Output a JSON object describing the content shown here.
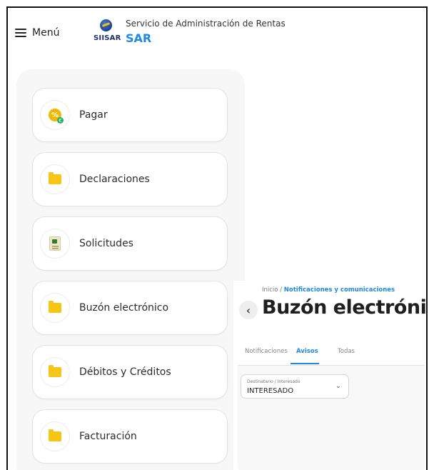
{
  "header": {
    "menu_label": "Menú",
    "logo_text": "SIISAR",
    "org_name": "Servicio de Administración de Rentas",
    "org_short": "SAR"
  },
  "menu": {
    "items": [
      {
        "label": "Pagar",
        "icon": "coin-icon"
      },
      {
        "label": "Declaraciones",
        "icon": "folder-icon"
      },
      {
        "label": "Solicitudes",
        "icon": "document-icon"
      },
      {
        "label": "Buzón electrónico",
        "icon": "folder-icon"
      },
      {
        "label": "Débitos y Créditos",
        "icon": "folder-icon"
      },
      {
        "label": "Facturación",
        "icon": "folder-icon"
      }
    ]
  },
  "inset": {
    "breadcrumb_home": "Inicio",
    "breadcrumb_sep": "/",
    "breadcrumb_current": "Notificaciones y comunicaciones",
    "back_glyph": "‹",
    "title": "Buzón electrónico",
    "tabs": [
      "Notificaciones",
      "Avisos",
      "Todas"
    ],
    "active_tab": "Avisos",
    "select_label": "Destinatario / Interesado",
    "select_value": "INTERESADO"
  },
  "colors": {
    "accent": "#1e88e5",
    "icon_yellow": "#f5c518",
    "panel_bg": "#f7f7f7"
  }
}
